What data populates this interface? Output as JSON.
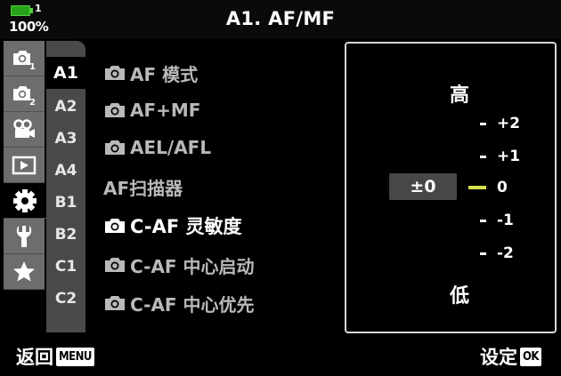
{
  "status": {
    "battery_level_indicator": "1",
    "battery_percent": "100%",
    "battery_color": "#2aa31c"
  },
  "title": "A1. AF/MF",
  "icon_tabs": [
    {
      "name": "shooting-menu-1-icon",
      "sub": "1"
    },
    {
      "name": "shooting-menu-2-icon",
      "sub": "2"
    },
    {
      "name": "video-menu-icon",
      "sub": ""
    },
    {
      "name": "playback-menu-icon",
      "sub": ""
    },
    {
      "name": "custom-menu-gear-icon",
      "sub": "",
      "active": true
    },
    {
      "name": "setup-wrench-icon",
      "sub": ""
    },
    {
      "name": "my-menu-star-icon",
      "sub": ""
    }
  ],
  "sub_tabs": [
    "A1",
    "A2",
    "A3",
    "A4",
    "B1",
    "B2",
    "C1",
    "C2"
  ],
  "active_sub_tab": "A1",
  "menu_items": [
    {
      "camera_icon": true,
      "label": "AF 模式"
    },
    {
      "camera_icon": true,
      "label": "AF+MF"
    },
    {
      "camera_icon": true,
      "label": "AEL/AFL"
    },
    {
      "camera_icon": false,
      "label": "AF扫描器"
    },
    {
      "camera_icon": true,
      "label": "C-AF 灵敏度",
      "active": true
    },
    {
      "camera_icon": true,
      "label": "C-AF 中心启动"
    },
    {
      "camera_icon": true,
      "label": "C-AF 中心优先"
    }
  ],
  "panel": {
    "high_label": "高",
    "low_label": "低",
    "current_value": "±0",
    "scale": [
      "+2",
      "+1",
      "0",
      "-1",
      "-2"
    ],
    "selected": "0",
    "selected_color": "#d6e24a"
  },
  "footer": {
    "back_label": "返回",
    "back_key": "MENU",
    "set_label": "设定",
    "set_key": "OK"
  }
}
